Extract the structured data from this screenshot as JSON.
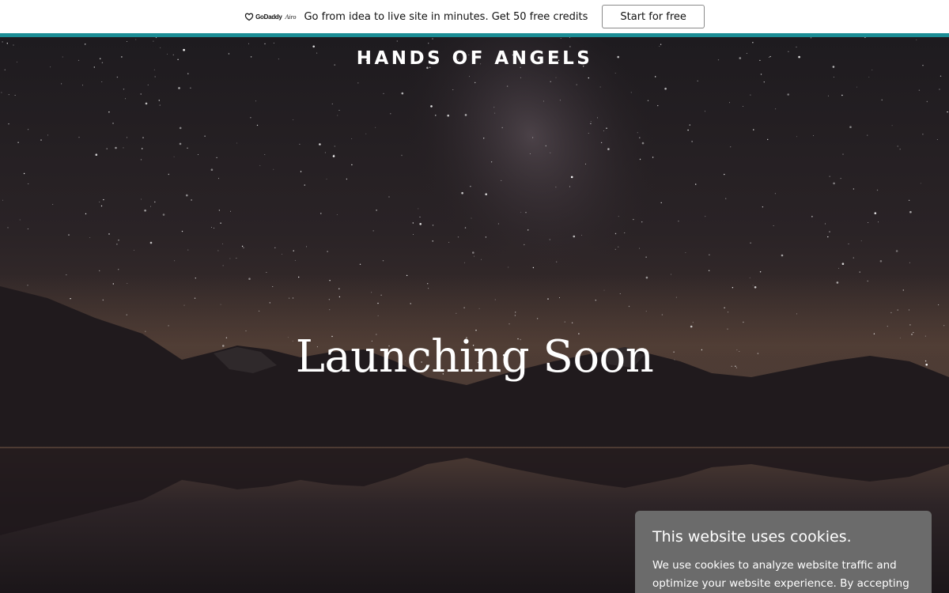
{
  "promo": {
    "logo_text": "GoDaddy",
    "logo_sub": "Airo",
    "message": "Go from idea to live site in minutes. Get 50 free credits",
    "cta_label": "Start for free",
    "accent_color": "#1b8d95"
  },
  "hero": {
    "site_title": "HANDS OF ANGELS",
    "headline": "Launching Soon"
  },
  "cookie": {
    "title": "This website uses cookies.",
    "body": "We use cookies to analyze website traffic and optimize your website experience. By accepting our"
  }
}
